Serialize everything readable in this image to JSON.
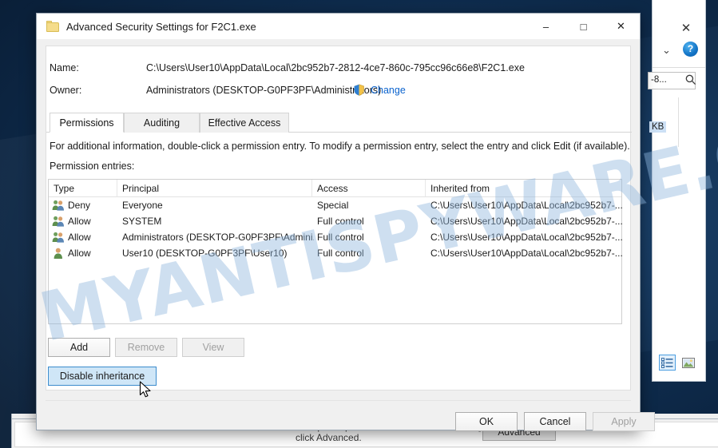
{
  "dialog": {
    "title": "Advanced Security Settings for F2C1.exe",
    "icon": "folder-icon",
    "window_buttons": {
      "minimize": "–",
      "maximize": "□",
      "close": "✕"
    },
    "name_label": "Name:",
    "name_value": "C:\\Users\\User10\\AppData\\Local\\2bc952b7-2812-4ce7-860c-795cc96c66e8\\F2C1.exe",
    "owner_label": "Owner:",
    "owner_value": "Administrators (DESKTOP-G0PF3PF\\Administrators)",
    "change_link": "Change",
    "tabs": [
      {
        "label": "Permissions",
        "active": true
      },
      {
        "label": "Auditing",
        "active": false
      },
      {
        "label": "Effective Access",
        "active": false
      }
    ],
    "info_text": "For additional information, double-click a permission entry. To modify a permission entry, select the entry and click Edit (if available).",
    "entries_label": "Permission entries:",
    "columns": [
      "Type",
      "Principal",
      "Access",
      "Inherited from"
    ],
    "rows": [
      {
        "icon": "group-icon",
        "type": "Deny",
        "principal": "Everyone",
        "access": "Special",
        "inherited_from": "C:\\Users\\User10\\AppData\\Local\\2bc952b7-..."
      },
      {
        "icon": "group-icon",
        "type": "Allow",
        "principal": "SYSTEM",
        "access": "Full control",
        "inherited_from": "C:\\Users\\User10\\AppData\\Local\\2bc952b7-..."
      },
      {
        "icon": "group-icon",
        "type": "Allow",
        "principal": "Administrators (DESKTOP-G0PF3PF\\Admini...",
        "access": "Full control",
        "inherited_from": "C:\\Users\\User10\\AppData\\Local\\2bc952b7-..."
      },
      {
        "icon": "user-icon",
        "type": "Allow",
        "principal": "User10 (DESKTOP-G0PF3PF\\User10)",
        "access": "Full control",
        "inherited_from": "C:\\Users\\User10\\AppData\\Local\\2bc952b7-..."
      }
    ],
    "buttons": {
      "add": "Add",
      "remove": "Remove",
      "view": "View",
      "disable_inheritance": "Disable inheritance",
      "ok": "OK",
      "cancel": "Cancel",
      "apply": "Apply"
    }
  },
  "background_explorer": {
    "close": "✕",
    "chevron": "⌄",
    "help": "?",
    "search_value": "-8...",
    "size_text": "KB"
  },
  "background_properties": {
    "hint_text": "For special permissions or advanced settings, click Advanced.",
    "advanced_button": "Advanced"
  },
  "watermark": {
    "text": "MYANTISPYWARE.COM"
  },
  "colors": {
    "accent_link": "#0b63ce",
    "hot_button": "#cfe6f7",
    "desktop_blue": "#153a62"
  }
}
